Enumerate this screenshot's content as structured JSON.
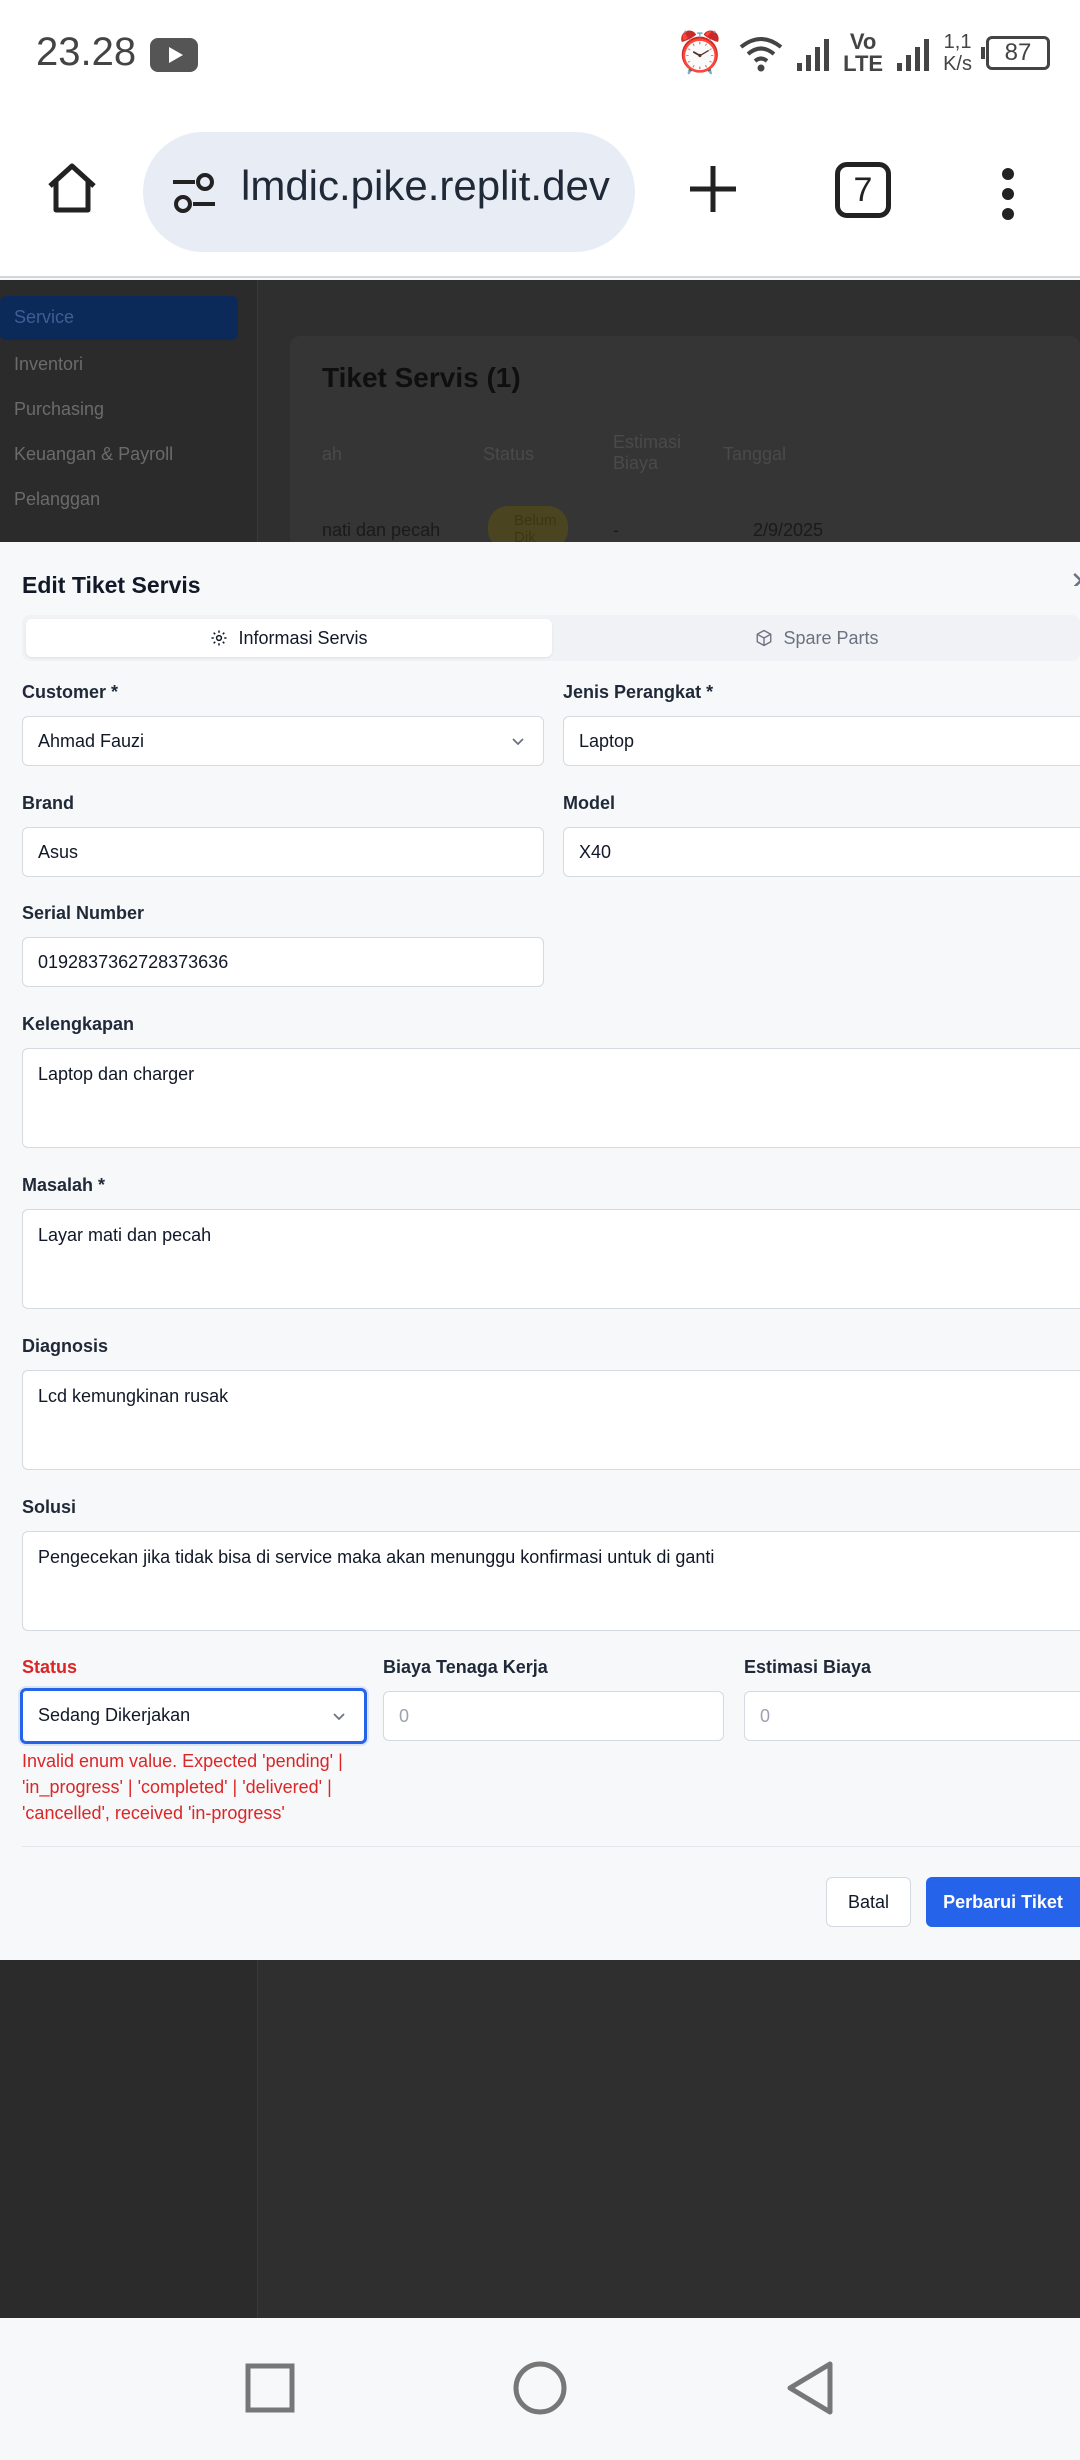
{
  "status_bar": {
    "time": "23.28",
    "volte_top": "Vo",
    "volte_bottom": "LTE",
    "speed_value": "1,1",
    "speed_unit": "K/s",
    "battery": "87"
  },
  "browser": {
    "url": "lmdic.pike.replit.dev",
    "tab_count": "7"
  },
  "background": {
    "sidebar_items": [
      "Service",
      "Inventori",
      "Purchasing",
      "Keuangan & Payroll",
      "Pelanggan"
    ],
    "card_title": "Tiket Servis (1)",
    "table_headers": [
      "ah",
      "Status",
      "Estimasi Biaya",
      "Tanggal"
    ],
    "row": {
      "issue": "nati dan pecah",
      "status": "Belum Dik",
      "estimate": "-",
      "date": "2/9/2025"
    }
  },
  "modal": {
    "title": "Edit Tiket Servis",
    "tabs": [
      {
        "label": "Informasi Servis",
        "icon": "gear-icon",
        "active": true
      },
      {
        "label": "Spare Parts",
        "icon": "package-icon",
        "active": false
      }
    ],
    "fields": {
      "customer": {
        "label": "Customer *",
        "value": "Ahmad Fauzi"
      },
      "device_type": {
        "label": "Jenis Perangkat *",
        "value": "Laptop"
      },
      "brand": {
        "label": "Brand",
        "value": "Asus"
      },
      "model": {
        "label": "Model",
        "value": "X40"
      },
      "serial": {
        "label": "Serial Number",
        "value": "0192837362728373636"
      },
      "accessories": {
        "label": "Kelengkapan",
        "value": "Laptop dan charger"
      },
      "problem": {
        "label": "Masalah *",
        "value": "Layar mati dan pecah"
      },
      "diagnosis": {
        "label": "Diagnosis",
        "value": "Lcd kemungkinan rusak"
      },
      "solution": {
        "label": "Solusi",
        "value": "Pengecekan jika tidak bisa di service maka akan menunggu konfirmasi untuk di ganti"
      },
      "status": {
        "label": "Status",
        "value": "Sedang Dikerjakan"
      },
      "labor_cost": {
        "label": "Biaya Tenaga Kerja",
        "placeholder": "0"
      },
      "estimated_cost": {
        "label": "Estimasi Biaya",
        "placeholder": "0"
      }
    },
    "error_message": "Invalid enum value. Expected 'pending' | 'in_progress' | 'completed' | 'delivered' | 'cancelled', received 'in-progress'",
    "buttons": {
      "cancel": "Batal",
      "submit": "Perbarui Tiket"
    }
  },
  "colors": {
    "accent": "#2563eb",
    "error": "#dc2626",
    "overlay": "#2f2f2f"
  }
}
